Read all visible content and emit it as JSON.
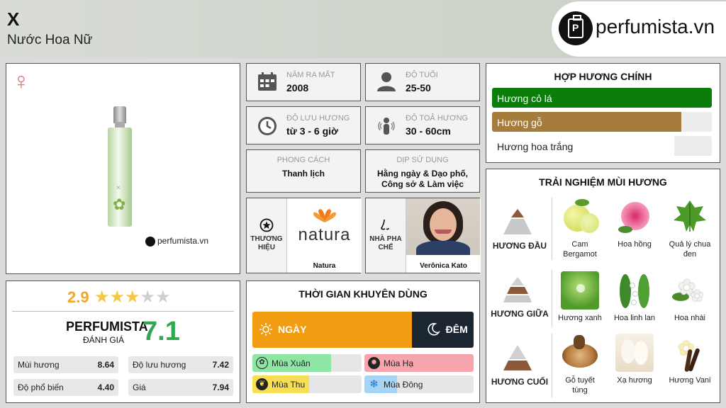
{
  "header": {
    "title": "X",
    "subtitle": "Nước Hoa Nữ",
    "brand": "perfumista.vn"
  },
  "product": {
    "watermark": "perfumista.vn"
  },
  "info": {
    "year": {
      "label": "Năm ra mắt",
      "value": "2008"
    },
    "age": {
      "label": "Độ tuổi",
      "value": "25-50"
    },
    "longevity": {
      "label": "Độ lưu hương",
      "value": "từ 3 - 6 giờ"
    },
    "sillage": {
      "label": "Độ toả hương",
      "value": "30 - 60cm"
    },
    "style": {
      "label": "PHONG CÁCH",
      "value": "Thanh lịch"
    },
    "occasion": {
      "label": "DỊP SỬ DỤNG",
      "value": "Hằng ngày & Dạo phố, Công sở & Làm việc"
    },
    "brand": {
      "label": "THƯƠNG HIỆU",
      "logo_text": "natura",
      "name": "Natura"
    },
    "perfumer": {
      "label": "NHÀ PHA CHẾ",
      "name": "Verônica Kato"
    }
  },
  "rating": {
    "score": "2.9",
    "stars": 2.9,
    "perfumista_label": "PERFUMISTA",
    "perfumista_sub": "ĐÁNH GIÁ",
    "perfumista_score": "7.1",
    "metrics": [
      {
        "label": "Mùi hương",
        "value": "8.64"
      },
      {
        "label": "Độ lưu hương",
        "value": "7.42"
      },
      {
        "label": "Độ phổ biến",
        "value": "4.40"
      },
      {
        "label": "Giá",
        "value": "7.94"
      }
    ]
  },
  "accords": {
    "title": "HỢP HƯƠNG CHÍNH",
    "items": [
      {
        "label": "Hương cỏ lá",
        "level": 100,
        "color": "#0a7d0a",
        "text_color": "#ffffff"
      },
      {
        "label": "Hương gỗ",
        "level": 86,
        "color": "#a67c3d",
        "text_color": "#ffffff"
      },
      {
        "label": "Hương hoa trắng",
        "level": 83,
        "color": "#ffffff",
        "text_color": "#222222"
      }
    ]
  },
  "time_usage": {
    "title": "THỜI GIAN KHUYÊN DÙNG",
    "day_label": "NGÀY",
    "night_label": "ĐÊM",
    "day_share": 72,
    "seasons": [
      {
        "label": "Mùa Xuân",
        "level": 72,
        "color": "#8ee6a4",
        "icon": "flower-icon"
      },
      {
        "label": "Mùa Hạ",
        "level": 100,
        "color": "#f6a5ad",
        "icon": "sun-icon"
      },
      {
        "label": "Mùa Thu",
        "level": 52,
        "color": "#f7de52",
        "icon": "leaf-icon"
      },
      {
        "label": "Mùa Đông",
        "level": 30,
        "color": "#a6d4f5",
        "icon": "snowflake-icon"
      }
    ]
  },
  "scent": {
    "title": "TRẢI NGHIỆM MÙI HƯƠNG",
    "top": {
      "label": "HƯƠNG ĐẦU",
      "notes": [
        "Cam Bergamot",
        "Hoa hồng",
        "Quả lý chua đen"
      ]
    },
    "middle": {
      "label": "HƯƠNG GIỮA",
      "notes": [
        "Hương xanh",
        "Hoa linh lan",
        "Hoa nhài"
      ]
    },
    "base": {
      "label": "HƯƠNG CUỐI",
      "notes": [
        "Gỗ tuyết tùng",
        "Xạ hương",
        "Hương Vani"
      ]
    }
  }
}
